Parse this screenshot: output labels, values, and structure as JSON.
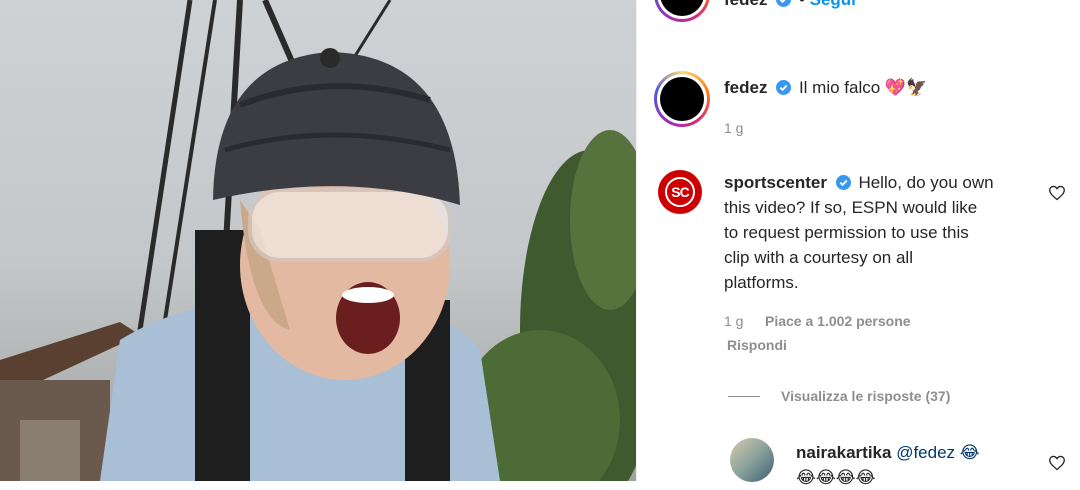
{
  "header": {
    "username": "fedez",
    "follow_label": "Segui"
  },
  "caption": {
    "username": "fedez",
    "text": "Il mio falco 💖🦅",
    "time": "1 g"
  },
  "comments": [
    {
      "username": "sportscenter",
      "lines": [
        "Hello, do you own",
        "this video? If so, ESPN would like",
        "to request permission to use this",
        "clip with a courtesy on all",
        "platforms."
      ],
      "avatar_text": "SC",
      "time": "1 g",
      "likes": "Piace a 1.002 persone",
      "reply_label": "Rispondi",
      "view_replies": "Visualizza le risposte (37)"
    },
    {
      "username": "nairakartika",
      "text": "@fedez 😂",
      "second_line": "😂😂😂😂"
    }
  ],
  "colors": {
    "verified": "#3897f0",
    "espn_red": "#cc0000",
    "link_blue": "#0095f6"
  },
  "icons": [
    "verified-badge-icon",
    "heart-icon"
  ]
}
